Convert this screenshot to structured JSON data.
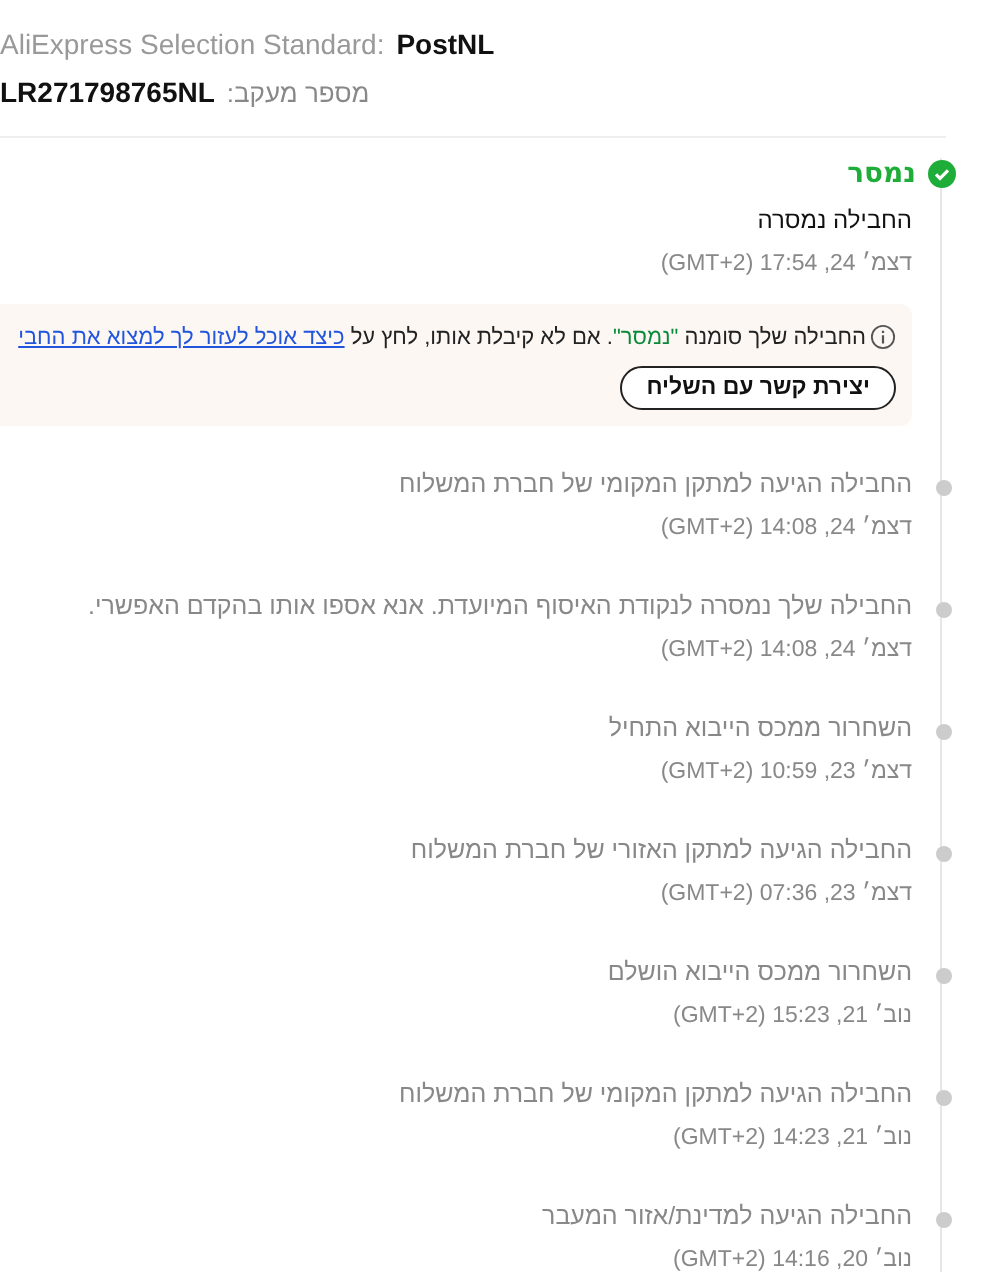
{
  "carrier": {
    "service": "AliExpress Selection Standard:",
    "name": "PostNL"
  },
  "tracking": {
    "label": "מספר מעקב:",
    "number": "LR271798765NL"
  },
  "status": {
    "label": "נמסר",
    "delivered": true
  },
  "events": [
    {
      "text": "החבילה נמסרה",
      "time": "דצמ׳ 24, 17:54 (GMT+2)",
      "current": true
    },
    {
      "text": "החבילה הגיעה למתקן המקומי של חברת המשלוח",
      "time": "דצמ׳ 24, 14:08 (GMT+2)",
      "current": false
    },
    {
      "text": "החבילה שלך נמסרה לנקודת האיסוף המיועדת. אנא אספו אותו בהקדם האפשרי.",
      "time": "דצמ׳ 24, 14:08 (GMT+2)",
      "current": false
    },
    {
      "text": "השחרור ממכס הייבוא התחיל",
      "time": "דצמ׳ 23, 10:59 (GMT+2)",
      "current": false
    },
    {
      "text": "החבילה הגיעה למתקן האזורי של חברת המשלוח",
      "time": "דצמ׳ 23, 07:36 (GMT+2)",
      "current": false
    },
    {
      "text": "השחרור ממכס הייבוא הושלם",
      "time": "נוב׳ 21, 15:23 (GMT+2)",
      "current": false
    },
    {
      "text": "החבילה הגיעה למתקן המקומי של חברת המשלוח",
      "time": "נוב׳ 21, 14:23 (GMT+2)",
      "current": false
    },
    {
      "text": "החבילה הגיעה למדינת/אזור המעבר",
      "time": "נוב׳ 20, 14:16 (GMT+2)",
      "current": false
    }
  ],
  "notice": {
    "text_before": "החבילה שלך סומנה ",
    "highlight": "\"נמסר\"",
    "text_after": ". אם לא קיבלת אותו, לחץ על ",
    "link": "כיצד אוכל לעזור לך למצוא את החבי",
    "button": "יצירת קשר עם השליח"
  }
}
